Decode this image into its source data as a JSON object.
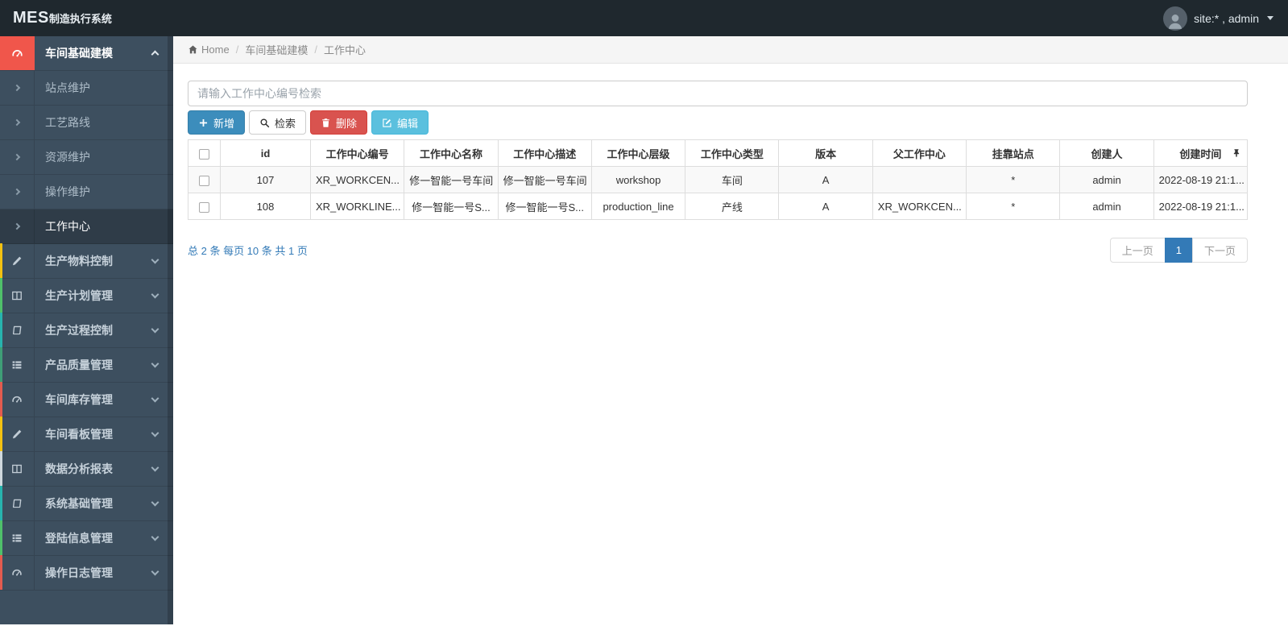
{
  "navbar": {
    "brand_bold": "MES",
    "brand_rest": "制造执行系统",
    "user": "site:* , admin"
  },
  "breadcrumb": {
    "home": "Home",
    "items": [
      "车间基础建模",
      "工作中心"
    ]
  },
  "sidebar": {
    "group": {
      "label": "车间基础建模",
      "icon": "tachometer",
      "accent": "#f0564b"
    },
    "subitems": [
      {
        "label": "站点维护",
        "active": false
      },
      {
        "label": "工艺路线",
        "active": false
      },
      {
        "label": "资源维护",
        "active": false
      },
      {
        "label": "操作维护",
        "active": false
      },
      {
        "label": "工作中心",
        "active": true
      }
    ],
    "items": [
      {
        "label": "生产物料控制",
        "icon": "pencil",
        "accent": "#f3c111"
      },
      {
        "label": "生产计划管理",
        "icon": "columns",
        "accent": "#4fc06a"
      },
      {
        "label": "生产过程控制",
        "icon": "book",
        "accent": "#27b4ae"
      },
      {
        "label": "产品质量管理",
        "icon": "list",
        "accent": "#3f9e77"
      },
      {
        "label": "车间库存管理",
        "icon": "tachometer",
        "accent": "#e35b4f"
      },
      {
        "label": "车间看板管理",
        "icon": "pencil",
        "accent": "#f3c111"
      },
      {
        "label": "数据分析报表",
        "icon": "columns",
        "accent": "#cfd8dd"
      },
      {
        "label": "系统基础管理",
        "icon": "book",
        "accent": "#27b4ae"
      },
      {
        "label": "登陆信息管理",
        "icon": "list",
        "accent": "#4fc06a"
      },
      {
        "label": "操作日志管理",
        "icon": "tachometer",
        "accent": "#e35b4f"
      }
    ]
  },
  "toolbar": {
    "search_placeholder": "请输入工作中心编号检索",
    "buttons": [
      {
        "label": "新增",
        "style": "primary",
        "icon": "plus",
        "name": "add-button"
      },
      {
        "label": "检索",
        "style": "default",
        "icon": "search",
        "name": "search-button"
      },
      {
        "label": "删除",
        "style": "danger",
        "icon": "trash",
        "name": "delete-button"
      },
      {
        "label": "编辑",
        "style": "info",
        "icon": "edit",
        "name": "edit-button"
      }
    ]
  },
  "table": {
    "columns": [
      "id",
      "工作中心编号",
      "工作中心名称",
      "工作中心描述",
      "工作中心层级",
      "工作中心类型",
      "版本",
      "父工作中心",
      "挂靠站点",
      "创建人",
      "创建时间"
    ],
    "rows": [
      [
        "107",
        "XR_WORKCEN...",
        "修一智能一号车间",
        "修一智能一号车间",
        "workshop",
        "车间",
        "A",
        "",
        "*",
        "admin",
        "2022-08-19 21:1..."
      ],
      [
        "108",
        "XR_WORKLINE...",
        "修一智能一号S...",
        "修一智能一号S...",
        "production_line",
        "产线",
        "A",
        "XR_WORKCEN...",
        "*",
        "admin",
        "2022-08-19 21:1..."
      ]
    ]
  },
  "pagination": {
    "summary": "总 2 条 每页 10 条 共 1 页",
    "prev": "上一页",
    "page": "1",
    "next": "下一页"
  },
  "colors": {
    "navbar_bg": "#1f282e",
    "sidebar_bg": "#3d4f5f",
    "sidebar_active_bg": "#2f3c48",
    "active_group_icon_bg": "#f0564b",
    "primary": "#3c8dbc",
    "danger": "#d9534f",
    "info": "#5bc0de",
    "link_blue": "#337ab7"
  }
}
